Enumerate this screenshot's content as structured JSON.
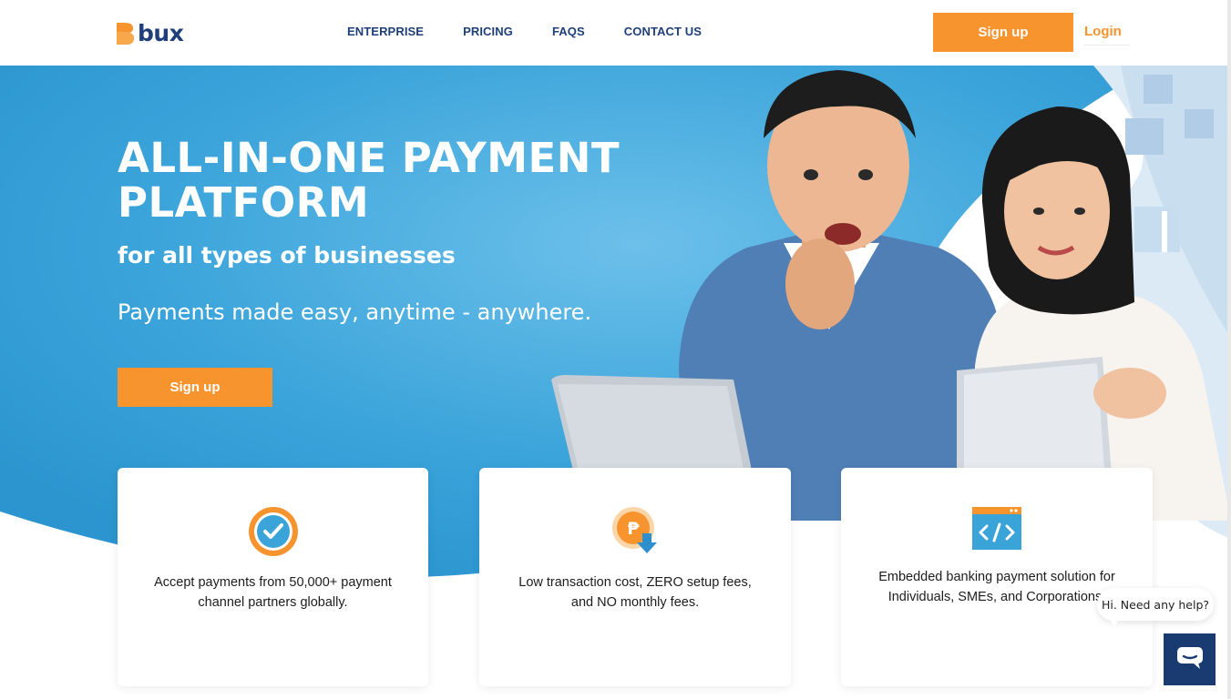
{
  "brand": {
    "name": "bux",
    "colors": {
      "navy": "#1f3f7a",
      "orange": "#f7942e",
      "blue": "#3aa3d8"
    }
  },
  "nav": {
    "items": [
      {
        "label": "ENTERPRISE"
      },
      {
        "label": "PRICING"
      },
      {
        "label": "FAQS"
      },
      {
        "label": "CONTACT US"
      }
    ],
    "signup_label": "Sign up",
    "login_label": "Login"
  },
  "hero": {
    "title": "ALL-IN-ONE PAYMENT PLATFORM",
    "subtitle": "for all types of businesses",
    "tagline": "Payments made easy, anytime - anywhere.",
    "cta_label": "Sign up",
    "image": "people-with-laptop-and-tablet"
  },
  "features": [
    {
      "icon": "check-badge-icon",
      "text": "Accept payments from 50,000+ payment channel partners globally."
    },
    {
      "icon": "peso-coin-down-icon",
      "text": "Low transaction cost, ZERO setup fees, and NO monthly fees."
    },
    {
      "icon": "code-window-icon",
      "text": "Embedded banking payment solution for Individuals, SMEs, and Corporations."
    }
  ],
  "chat": {
    "prompt": "Hi. Need any help?",
    "icon": "chat-icon"
  }
}
